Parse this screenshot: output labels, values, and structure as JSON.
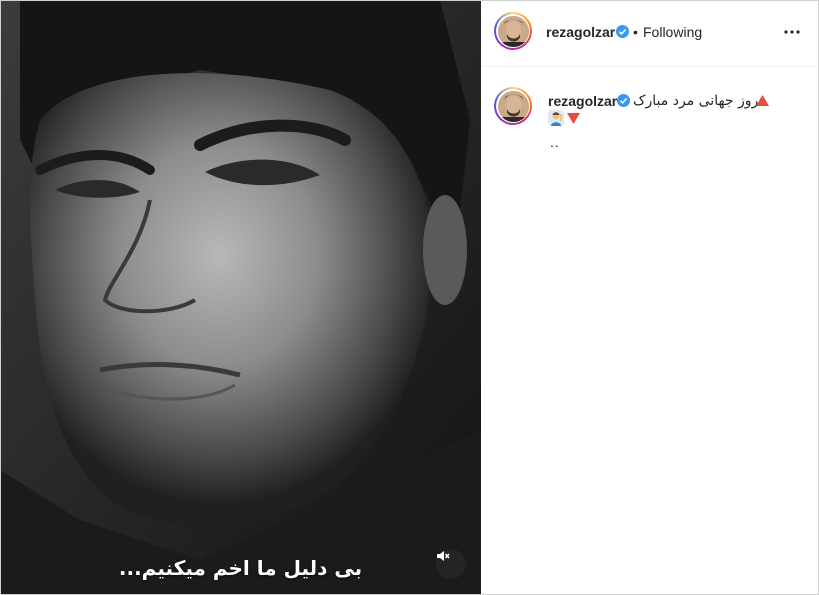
{
  "media": {
    "subtitle": "بی دلیل ما اخم میکنیم...",
    "mute_icon": "speaker-muted-icon"
  },
  "header": {
    "username": "rezagolzar",
    "separator": "•",
    "follow_status": "Following",
    "more_icon": "more-horizontal-icon"
  },
  "caption": {
    "username": "rezagolzar",
    "text": "روز جهانی مرد مبارک",
    "line3": ".."
  },
  "colors": {
    "verified": "#3897f0",
    "triangle_red": "#e74c3c"
  }
}
